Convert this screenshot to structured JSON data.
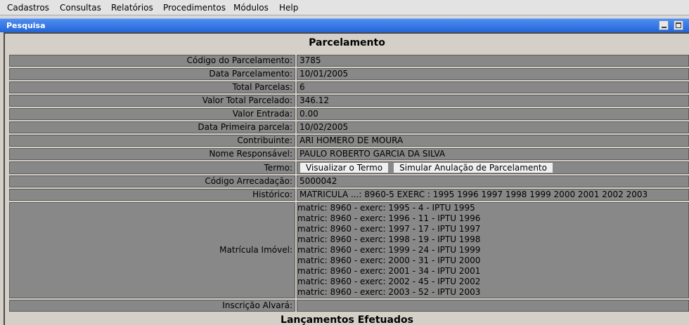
{
  "menu": [
    "Cadastros",
    "Consultas",
    "Relatórios",
    "Procedimentos",
    "Módulos",
    "Help"
  ],
  "window": {
    "title": "Pesquisa"
  },
  "section_title": "Parcelamento",
  "fields": {
    "codigo_parcelamento": {
      "label": "Código do Parcelamento:",
      "value": "3785"
    },
    "data_parcelamento": {
      "label": "Data Parcelamento:",
      "value": "10/01/2005"
    },
    "total_parcelas": {
      "label": "Total Parcelas:",
      "value": "6"
    },
    "valor_total": {
      "label": "Valor Total Parcelado:",
      "value": "346.12"
    },
    "valor_entrada": {
      "label": "Valor Entrada:",
      "value": "0.00"
    },
    "data_primeira": {
      "label": "Data Primeira parcela:",
      "value": "10/02/2005"
    },
    "contribuinte": {
      "label": "Contribuinte:",
      "value": "ARI HOMERO DE MOURA"
    },
    "nome_responsavel": {
      "label": "Nome Responsável:",
      "value": "PAULO ROBERTO GARCIA DA SILVA"
    },
    "termo": {
      "label": "Termo:",
      "btn_visualizar": "Visualizar o Termo",
      "btn_simular": "Simular Anulação de Parcelamento"
    },
    "codigo_arrecadacao": {
      "label": "Código Arrecadação:",
      "value": "5000042"
    },
    "historico": {
      "label": "Histórico:",
      "value": "MATRICULA ...: 8960-5 EXERC : 1995 1996 1997 1998 1999 2000 2001 2002 2003"
    },
    "matricula_imovel": {
      "label": "Matrícula Imóvel:",
      "items": [
        "matric: 8960 - exerc: 1995 - 4 - IPTU 1995",
        "matric: 8960 - exerc: 1996 - 11 - IPTU 1996",
        "matric: 8960 - exerc: 1997 - 17 - IPTU 1997",
        "matric: 8960 - exerc: 1998 - 19 - IPTU 1998",
        "matric: 8960 - exerc: 1999 - 24 - IPTU 1999",
        "matric: 8960 - exerc: 2000 - 31 - IPTU 2000",
        "matric: 8960 - exerc: 2001 - 34 - IPTU 2001",
        "matric: 8960 - exerc: 2002 - 45 - IPTU 2002",
        "matric: 8960 - exerc: 2003 - 52 - IPTU 2003"
      ]
    },
    "inscricao_alvara": {
      "label": "Inscrição Alvará:",
      "value": ""
    }
  },
  "section2_title": "Lançamentos Efetuados",
  "colors": {
    "titlebar": "#2f72e4",
    "cell_bg": "#888888",
    "panel_bg": "#d4d0c8"
  }
}
